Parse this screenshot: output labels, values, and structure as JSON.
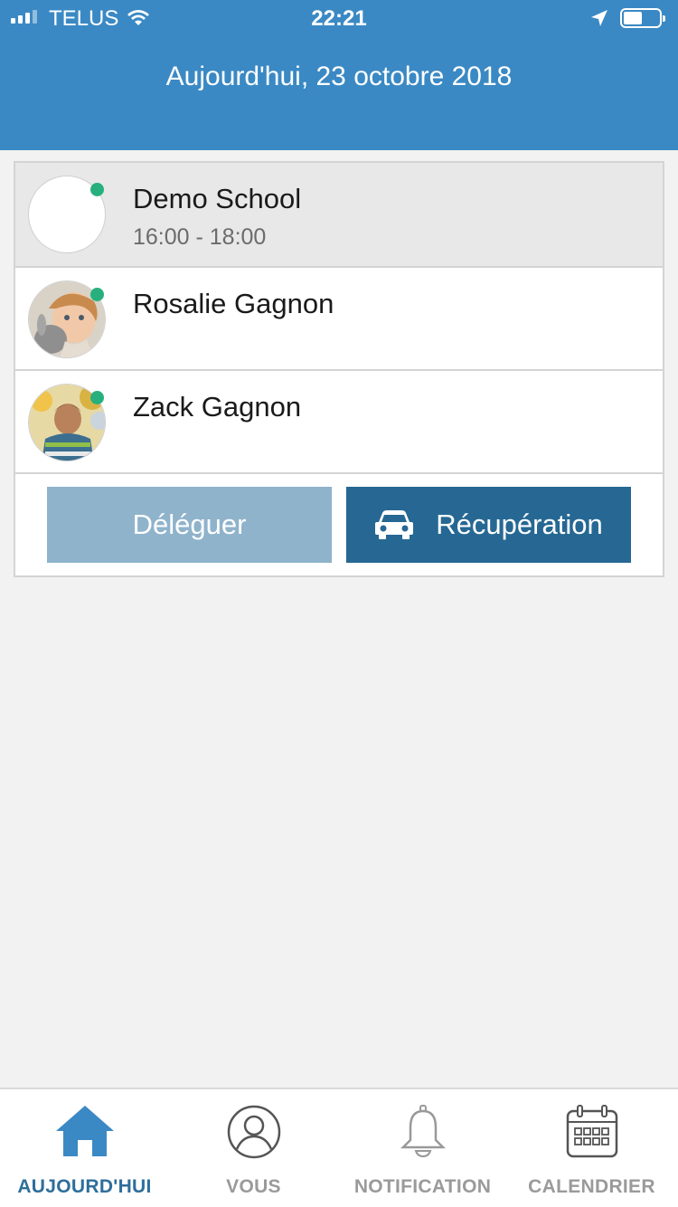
{
  "status_bar": {
    "carrier": "TELUS",
    "time": "22:21"
  },
  "header": {
    "date_title": "Aujourd'hui, 23 octobre 2018"
  },
  "school": {
    "name": "Demo School",
    "hours": "16:00 - 18:00",
    "presence_color": "#27b07d"
  },
  "children": [
    {
      "name": "Rosalie Gagnon"
    },
    {
      "name": "Zack Gagnon"
    }
  ],
  "actions": {
    "delegate_label": "Déléguer",
    "pickup_label": "Récupération",
    "pickup_icon": "car-icon"
  },
  "tabs": [
    {
      "label": "AUJOURD'HUI",
      "icon": "home-icon",
      "active": true
    },
    {
      "label": "VOUS",
      "icon": "user-icon",
      "active": false
    },
    {
      "label": "NOTIFICATION",
      "icon": "bell-icon",
      "active": false
    },
    {
      "label": "CALENDRIER",
      "icon": "calendar-icon",
      "active": false
    }
  ],
  "colors": {
    "header": "#3a89c4",
    "delegate_button": "#8fb3cb",
    "pickup_button": "#266893",
    "active_tab": "#2e6e9b"
  }
}
